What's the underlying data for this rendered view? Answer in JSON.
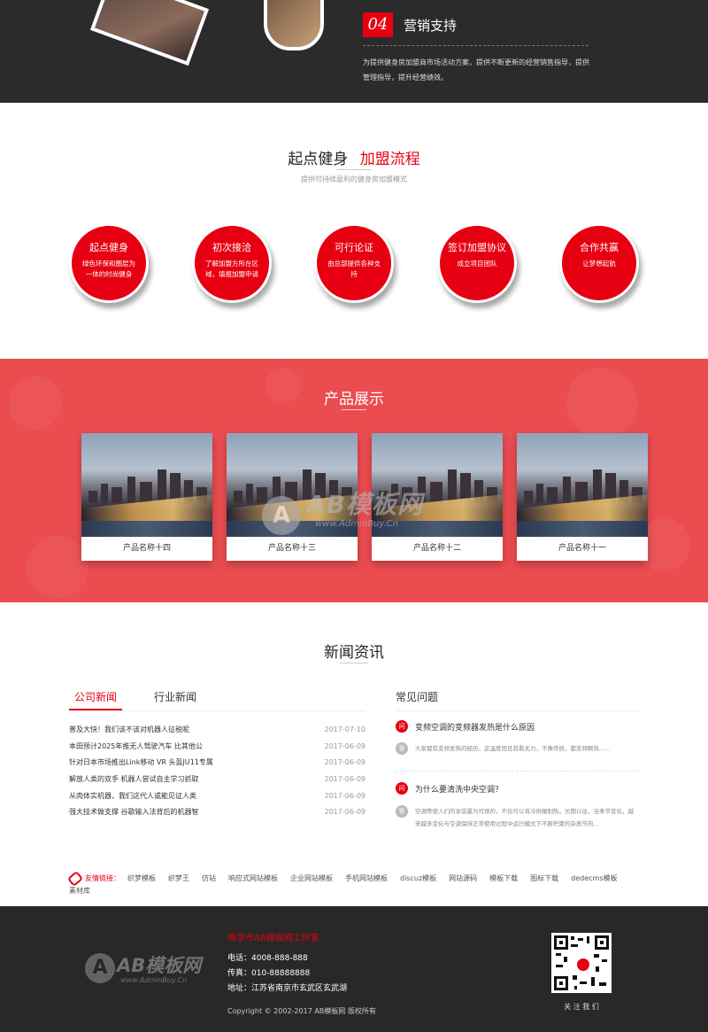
{
  "marketing": {
    "number": "04",
    "title": "营销支持",
    "description": "为提供健身房加盟商市场活动方案，提供不断更新的经营销售指导，提供管理指导，提升经营绩效。"
  },
  "process": {
    "title_main": "起点健身",
    "title_accent": "加盟流程",
    "subtitle": "提供可持续盈利的健身房加盟模式",
    "steps": [
      {
        "title": "起点健身",
        "desc": "绿色环保和圈层为一体的时尚健身"
      },
      {
        "title": "初次接洽",
        "desc": "了解加盟方所在区域，填报加盟申请"
      },
      {
        "title": "可行论证",
        "desc": "由总部提供各种支持"
      },
      {
        "title": "签订加盟协议",
        "desc": "成立项目团队"
      },
      {
        "title": "合作共赢",
        "desc": "让梦想起航"
      }
    ]
  },
  "products": {
    "title": "产品展示",
    "items": [
      {
        "name": "产品名称十四"
      },
      {
        "name": "产品名称十三"
      },
      {
        "name": "产品名称十二"
      },
      {
        "name": "产品名称十一"
      }
    ]
  },
  "watermark": {
    "logo_letter": "A",
    "brand": "AB模板网",
    "url": "www.AdminBuy.Cn"
  },
  "news": {
    "title": "新闻资讯",
    "tabs": [
      {
        "label": "公司新闻"
      },
      {
        "label": "行业新闻"
      }
    ],
    "items": [
      {
        "title": "普及大快！我们该不该对机器人征税呢",
        "date": "2017-07-10"
      },
      {
        "title": "本田预计2025年推无人驾驶汽车 比其他公",
        "date": "2017-06-09"
      },
      {
        "title": "针对日本市场推出Link移动 VR 头盔JU11专属",
        "date": "2017-06-09"
      },
      {
        "title": "解放人类的双手 机器人尝试自主学习抓取",
        "date": "2017-06-09"
      },
      {
        "title": "从肉体实机器，我们这代人或能见证人类",
        "date": "2017-06-09"
      },
      {
        "title": "强大技术做支撑 谷歌输入法背后的机器智",
        "date": "2017-06-09"
      }
    ],
    "faq": {
      "title": "常见问题",
      "q_label": "问",
      "a_label": "答",
      "items": [
        {
          "q": "变频空调的变频器发热是什么原因",
          "a": "大家都有变频发热的经历，这温度而且其看无力，不像传统，都变频颗热......"
        },
        {
          "q": "为什么要清洗中央空调？",
          "a": "空调等使人们的享受最为可观的，不仅可以将冷供暖制热，长期以往，当季节变化，越来越多变化与空调保持正常使用过程中运行模式下不断积聚的杂质节的..."
        }
      ]
    }
  },
  "friend_links": {
    "label": "友情链接：",
    "items": [
      "织梦模板",
      "织梦王",
      "仿站",
      "响应式网站模板",
      "企业网站模板",
      "手机网站模板",
      "discuz模板",
      "网站源码",
      "模板下载",
      "图标下载",
      "dedecms模板",
      "素材库"
    ]
  },
  "footer": {
    "logo_letter": "A",
    "logo_text": "AB模板网",
    "logo_url": "www.AdminBuy.Cn",
    "company": "南京市AB模板网工作室",
    "phone": "电话：4008-888-888",
    "fax": "传真：010-88888888",
    "address": "地址：江苏省南京市玄武区玄武湖",
    "copyright": "Copyright © 2002-2017 AB模板网 版权所有",
    "qr_caption": "关 注 我 们"
  },
  "colors": {
    "accent": "#e60012",
    "product_band": "#ea4c50",
    "dark": "#282828"
  }
}
